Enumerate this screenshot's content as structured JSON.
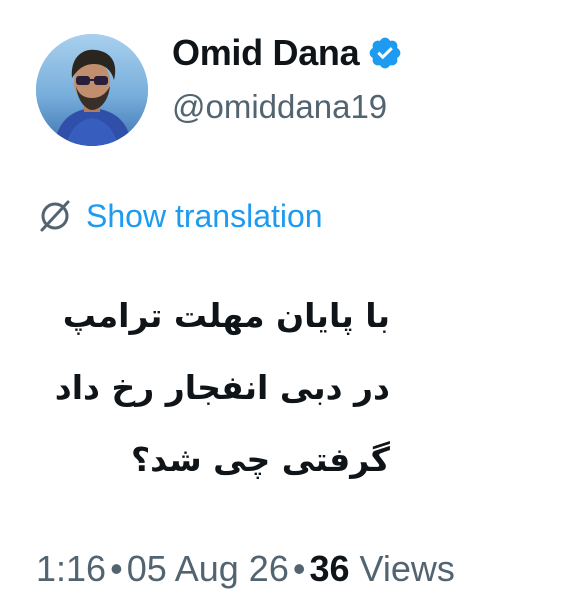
{
  "author": {
    "display_name": "Omid Dana",
    "handle": "@omiddana19",
    "verified": true,
    "verified_color": "#1d9bf0"
  },
  "translation": {
    "label": "Show translation",
    "icon": "translate-icon"
  },
  "tweet": {
    "lines": [
      "با پایان مهلت ترامپ",
      "در دبی انفجار رخ داد",
      "گرفتی چی شد؟"
    ]
  },
  "meta": {
    "time": "1:16",
    "separator": "•",
    "date": "05 Aug 26",
    "views_count": "36",
    "views_label": "Views"
  },
  "colors": {
    "text": "#0f1419",
    "secondary": "#536471",
    "accent": "#1d9bf0"
  }
}
